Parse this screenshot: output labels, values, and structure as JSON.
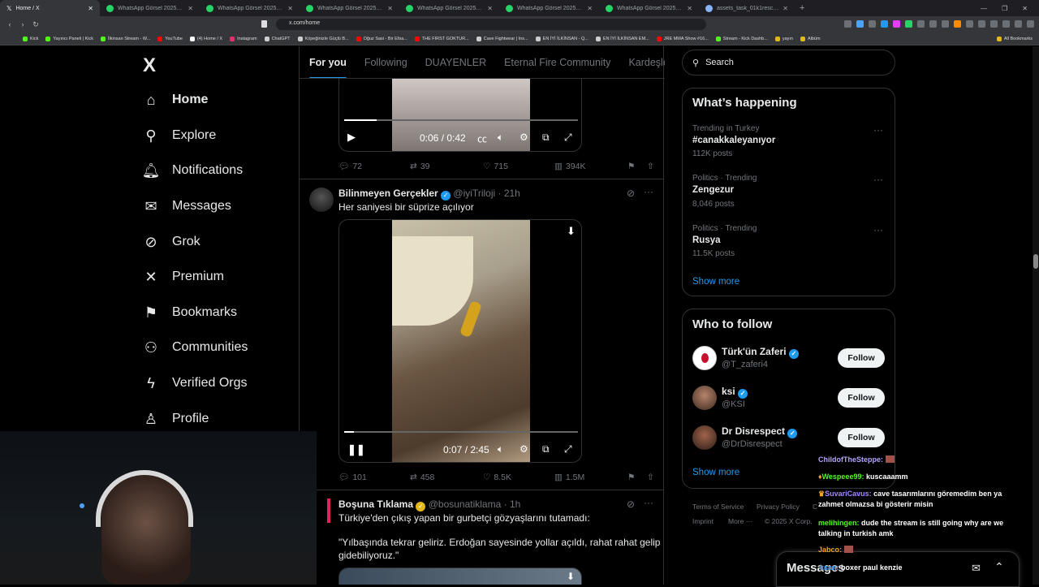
{
  "browser": {
    "tabs": [
      {
        "label": "Home / X",
        "active": true
      },
      {
        "label": "WhatsApp Görsel 2025-08-08 saat 1"
      },
      {
        "label": "WhatsApp Görsel 2025-08-09 saat 0"
      },
      {
        "label": "WhatsApp Görsel 2025-08-09 saat 2"
      },
      {
        "label": "WhatsApp Görsel 2025-08-09 saat 2"
      },
      {
        "label": "WhatsApp Görsel 2025-08-08 saat 2"
      },
      {
        "label": "WhatsApp Görsel 2025-08-08 saat 2"
      },
      {
        "label": "assets_task_01k1rescr7fw789e1psh"
      }
    ],
    "new_tab": "+",
    "url": "x.com/home",
    "bookmarks": [
      "Kick",
      "Yayıncı Paneli | Kick",
      "İlkinsan Stream - W...",
      "YouTube",
      "(4) Home / X",
      "Instagram",
      "ChatGPT",
      "Köpeğinizle Güçlü B...",
      "Oğuz Sasi - Bir Efsa...",
      "THE FIRST GOKTUR...",
      "Cave Fightwear | Ins...",
      "EN İYİ İLKİNSAN - Q...",
      "EN İYİ İLKİNSAN EM...",
      "JRE MMA Show #16...",
      "Stream - Kick Dashb...",
      "yayın",
      "Albüm"
    ],
    "all_bookmarks": "All Bookmarks"
  },
  "nav": {
    "logo": "X",
    "items": [
      {
        "label": "Home",
        "icon": "home-icon",
        "glyph": "⌂"
      },
      {
        "label": "Explore",
        "icon": "search-icon",
        "glyph": "⚲"
      },
      {
        "label": "Notifications",
        "icon": "bell-icon",
        "glyph": "🔔︎"
      },
      {
        "label": "Messages",
        "icon": "mail-icon",
        "glyph": "✉"
      },
      {
        "label": "Grok",
        "icon": "grok-icon",
        "glyph": "⊘"
      },
      {
        "label": "Premium",
        "icon": "x-icon",
        "glyph": "✕"
      },
      {
        "label": "Bookmarks",
        "icon": "bookmark-icon",
        "glyph": "⚑"
      },
      {
        "label": "Communities",
        "icon": "communities-icon",
        "glyph": "⚇"
      },
      {
        "label": "Verified Orgs",
        "icon": "lightning-icon",
        "glyph": "ϟ"
      },
      {
        "label": "Profile",
        "icon": "profile-icon",
        "glyph": "♙"
      }
    ]
  },
  "feed": {
    "tabs": [
      "For you",
      "Following",
      "DUAYENLER",
      "Eternal Fire Community",
      "Kardeşler Ki"
    ],
    "post1": {
      "time": "0:06 / 0:42",
      "progress": 0.14,
      "replies": "72",
      "reposts": "39",
      "likes": "715",
      "views": "394K"
    },
    "post2": {
      "name": "Bilinmeyen Gerçekler",
      "handle": "@iyiTriloji",
      "age": "· 21h",
      "text": "Her saniyesi bir süprize açılıyor",
      "time": "0:07 / 2:45",
      "progress": 0.04,
      "replies": "101",
      "reposts": "458",
      "likes": "8.5K",
      "views": "1.5M"
    },
    "post3": {
      "name": "Boşuna Tıklama",
      "handle": "@bosunatiklama",
      "age": "· 1h",
      "line1": "Türkiye'den çıkış yapan bir gurbetçi gözyaşlarını tutamadı:",
      "line2": "\"Yılbaşında tekrar geliriz. Erdoğan sayesinde yollar açıldı, rahat rahat gelip",
      "line3": "gidebiliyoruz.\""
    }
  },
  "sidebar": {
    "search_placeholder": "Search",
    "happening_title": "What’s happening",
    "trends": [
      {
        "meta": "Trending in Turkey",
        "name": "#canakkaleyanıyor",
        "count": "112K posts"
      },
      {
        "meta": "Politics · Trending",
        "name": "Zengezur",
        "count": "8,046 posts"
      },
      {
        "meta": "Politics · Trending",
        "name": "Rusya",
        "count": "11.5K posts"
      }
    ],
    "show_more": "Show more",
    "wtf_title": "Who to follow",
    "follow_label": "Follow",
    "wtf": [
      {
        "name": "Türk'ün Zaferi",
        "handle": "@T_zaferi4"
      },
      {
        "name": "ksi",
        "handle": "@KSI"
      },
      {
        "name": "Dr Disrespect",
        "handle": "@DrDisrespect"
      }
    ],
    "footer": [
      "Terms of Service",
      "Privacy Policy",
      "C",
      "Imprint",
      "More ···",
      "© 2025 X Corp."
    ]
  },
  "messages_label": "Messages",
  "chat": [
    {
      "user": "ChildofTheSteppe:",
      "text": "",
      "color": "#b6a3ff"
    },
    {
      "user": "Wespeee99:",
      "text": "kuscaaamm",
      "color": "#53fc18"
    },
    {
      "user": "SuvariCavus:",
      "text": "cave tasarımlarını göremedim ben ya",
      "text2": "zahmet olmazsa bi gösterir misin",
      "color": "#a389ff"
    },
    {
      "user": "melihingen:",
      "text": "dude the stream is still going why are we",
      "text2": "talking in turkish amk",
      "color": "#53fc18"
    },
    {
      "user": "Jabco:",
      "text": "",
      "color": "#f5a623"
    },
    {
      "user": "ksan:",
      "text": "boxer paul kenzie",
      "color": "#4aa3ff"
    }
  ]
}
